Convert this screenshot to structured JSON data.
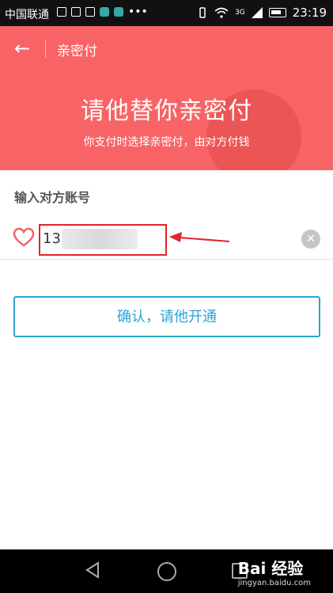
{
  "status_bar": {
    "carrier": "中国联通",
    "network": "3G",
    "time": "23:19"
  },
  "header": {
    "back_icon": "arrow-left-icon",
    "title": "亲密付",
    "hero_title": "请他替你亲密付",
    "hero_subtitle": "你支付时选择亲密付，由对方付钱",
    "background_color": "#f86466"
  },
  "form": {
    "section_label": "输入对方账号",
    "account_value": "13",
    "heart_icon": "heart-icon",
    "clear_icon": "clear-icon",
    "confirm_label": "确认，请他开通",
    "accent_color": "#2aa3d8"
  },
  "watermark": {
    "brand": "Bai 经验",
    "site": "jingyan.baidu.com"
  }
}
